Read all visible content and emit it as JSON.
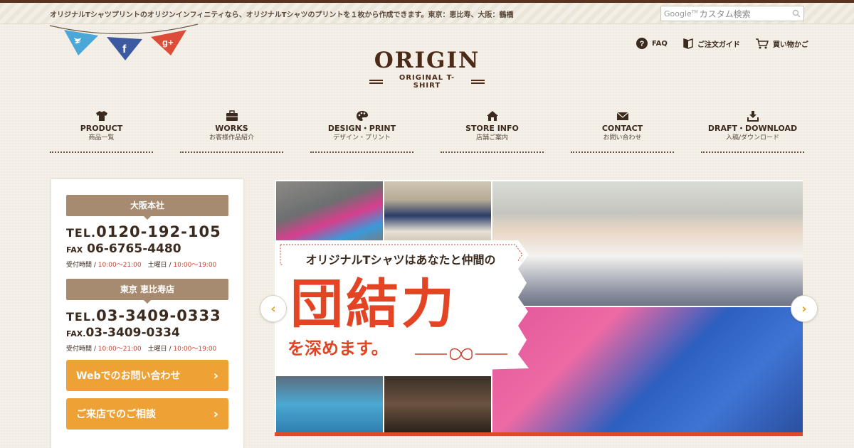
{
  "header": {
    "tagline": "オリジナルTシャツプリントのオリジンインフィニティなら、オリジナルTシャツのプリントを１枚から作成できます。東京：恵比寿、大阪：鶴橋",
    "search_brand": "Google",
    "search_brand_suffix": "TM",
    "search_placeholder": "カスタム検索"
  },
  "social": [
    "twitter-icon",
    "facebook-icon",
    "googleplus-icon"
  ],
  "util_nav": [
    {
      "label": "FAQ",
      "icon": "question-icon"
    },
    {
      "label": "ご注文ガイド",
      "icon": "guide-icon"
    },
    {
      "label": "買い物かご",
      "icon": "cart-icon"
    }
  ],
  "logo": {
    "main": "ORIGIN",
    "sub": "ORIGINAL T-SHIRT"
  },
  "gnav": [
    {
      "en": "PRODUCT",
      "ja": "商品一覧",
      "icon": "tshirt-icon"
    },
    {
      "en": "WORKS",
      "ja": "お客様作品紹介",
      "icon": "briefcase-icon"
    },
    {
      "en": "DESIGN・PRINT",
      "ja": "デザイン・プリント",
      "icon": "palette-icon"
    },
    {
      "en": "STORE INFO",
      "ja": "店舗ご案内",
      "icon": "home-icon"
    },
    {
      "en": "CONTACT",
      "ja": "お問い合わせ",
      "icon": "mail-icon"
    },
    {
      "en": "DRAFT・DOWNLOAD",
      "ja": "入稿/ダウンロード",
      "icon": "download-icon"
    }
  ],
  "offices": [
    {
      "title": "大阪本社",
      "tel_prefix": "TEL.",
      "tel": "0120-192-105",
      "fax_prefix": "FAX",
      "fax": " 06-6765-4480",
      "hours_label": "受付時間 / ",
      "hours": "10:00〜21:00",
      "sat_label": "　土曜日 / ",
      "sat_hours": "10:00〜19:00"
    },
    {
      "title": "東京 恵比寿店",
      "tel_prefix": "TEL.",
      "tel": "03-3409-0333",
      "fax_prefix": "FAX.",
      "fax": "03-3409-0334",
      "hours_label": "受付時間 / ",
      "hours": "10:00〜21:00",
      "sat_label": "　土曜日 / ",
      "sat_hours": "10:00〜19:00"
    }
  ],
  "buttons": [
    {
      "label": "Webでのお問い合わせ"
    },
    {
      "label": "ご来店でのご相談"
    }
  ],
  "slider": {
    "caption_top": "オリジナルTシャツはあなたと仲間の",
    "caption_main": "団結力",
    "caption_bottom": "を深めます。",
    "prev": "‹",
    "next": "›"
  },
  "colors": {
    "brand_brown": "#4b2a17",
    "accent_orange": "#eea134",
    "accent_red": "#e24424",
    "office_title_bg": "#a78b70"
  }
}
